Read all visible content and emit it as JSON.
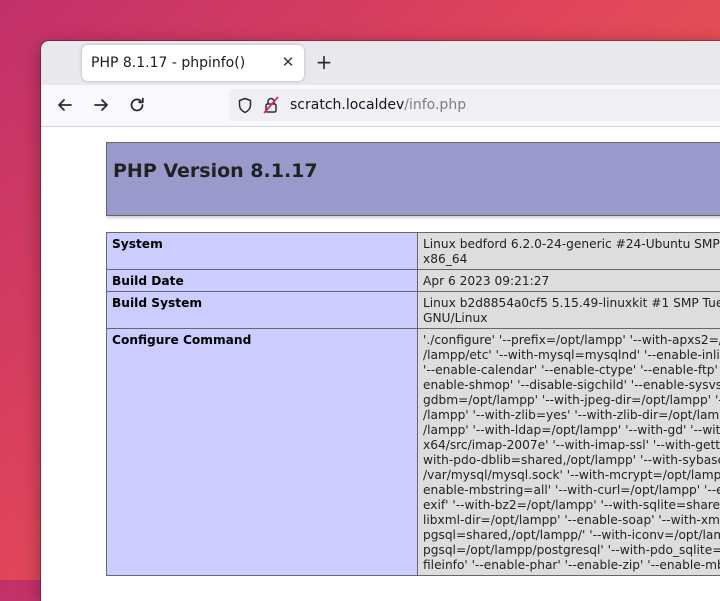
{
  "browser": {
    "tab": {
      "title": "PHP 8.1.17 - phpinfo()"
    },
    "url": {
      "host": "scratch.localdev",
      "path": "/info.php"
    }
  },
  "phpinfo": {
    "header": "PHP Version 8.1.17",
    "rows": [
      {
        "key": "System",
        "value": "Linux bedford 6.2.0-24-generic #24-Ubuntu SMP P\nx86_64"
      },
      {
        "key": "Build Date",
        "value": "Apr 6 2023 09:21:27"
      },
      {
        "key": "Build System",
        "value": "Linux b2d8854a0cf5 5.15.49-linuxkit #1 SMP Tue\nGNU/Linux"
      },
      {
        "key": "Configure Command",
        "value": "'./configure' '--prefix=/opt/lampp' '--with-apxs2=/o\n/lampp/etc' '--with-mysql=mysqlnd' '--enable-inlin\n'--enable-calendar' '--enable-ctype' '--enable-ftp' '\nenable-shmop' '--disable-sigchild' '--enable-sysvse\ngdbm=/opt/lampp' '--with-jpeg-dir=/opt/lampp' '--\n/lampp' '--with-zlib=yes' '--with-zlib-dir=/opt/lamp\n/lampp' '--with-ldap=/opt/lampp' '--with-gd' '--with\nx64/src/imap-2007e' '--with-imap-ssl' '--with-gette\nwith-pdo-dblib=shared,/opt/lampp' '--with-sybase\n/var/mysql/mysql.sock' '--with-mcrypt=/opt/lampp\nenable-mbstring=all' '--with-curl=/opt/lampp' '--en\nexif' '--with-bz2=/opt/lampp' '--with-sqlite=shared\nlibxml-dir=/opt/lampp' '--enable-soap' '--with-xmlr\npgsql=shared,/opt/lampp/' '--with-iconv=/opt/lamp\npgsql=/opt/lampp/postgresql' '--with-pdo_sqlite=/\nfileinfo' '--enable-phar' '--enable-zip' '--enable-mb"
      }
    ]
  }
}
